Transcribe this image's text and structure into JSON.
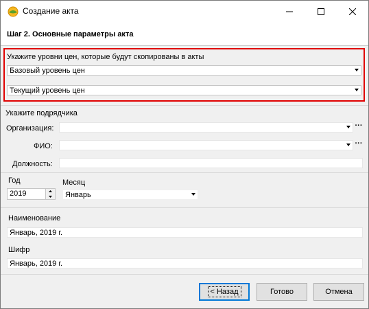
{
  "window": {
    "title": "Создание акта"
  },
  "header": {
    "title": "Шаг 2. Основные параметры акта"
  },
  "price_levels": {
    "label": "Укажите уровни цен, которые будут скопированы в акты",
    "base_value": "Базовый уровень цен",
    "current_value": "Текущий уровень цен"
  },
  "contractor": {
    "label": "Укажите подрядчика",
    "organization_label": "Организация:",
    "organization_value": "",
    "fio_label": "ФИО:",
    "fio_value": "",
    "position_label": "Должность:",
    "position_value": ""
  },
  "period": {
    "year_label": "Год",
    "year_value": "2019",
    "month_label": "Месяц",
    "month_value": "Январь"
  },
  "naming": {
    "name_label": "Наименование",
    "name_value": "Январь, 2019 г.",
    "code_label": "Шифр",
    "code_value": "Январь, 2019 г."
  },
  "buttons": {
    "back": "< Назад",
    "done": "Готово",
    "cancel": "Отмена"
  },
  "colors": {
    "highlight_border": "#e00000",
    "focus_border": "#0078d7"
  },
  "icons": [
    "app-icon",
    "minimize-icon",
    "maximize-icon",
    "close-icon",
    "dropdown-arrow-icon",
    "ellipsis-icon",
    "spin-up-icon",
    "spin-down-icon"
  ]
}
